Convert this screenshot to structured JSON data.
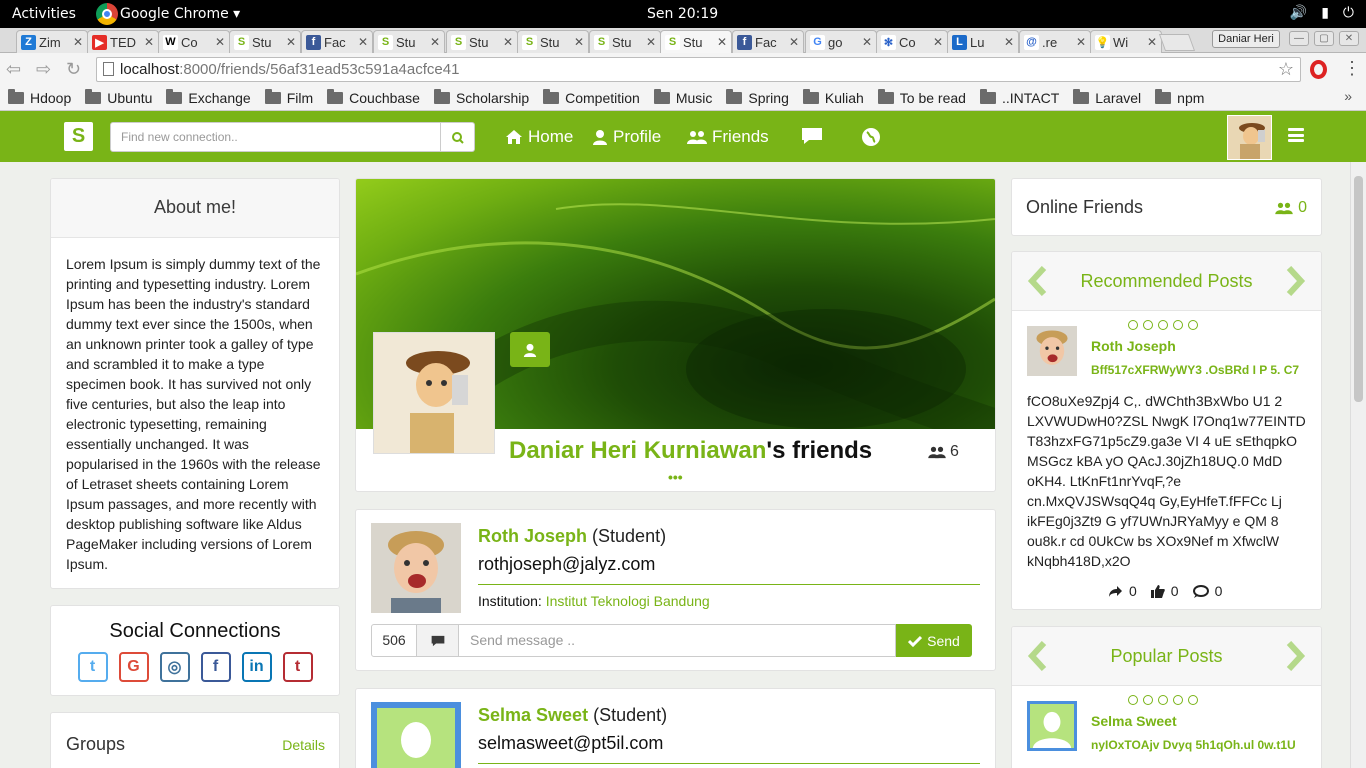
{
  "os": {
    "activities": "Activities",
    "app_menu": "Google Chrome ▾",
    "clock": "Sen 20:19"
  },
  "browser": {
    "tabs": [
      {
        "label": "Zim",
        "icon": "Z",
        "icon_bg": "#1f7ad6",
        "icon_color": "#ffffff"
      },
      {
        "label": "TED",
        "icon": "▶",
        "icon_bg": "#e52d27",
        "icon_color": "#ffffff"
      },
      {
        "label": "Co",
        "icon": "W",
        "icon_bg": "#ffffff",
        "icon_color": "#000000"
      },
      {
        "label": "Stu",
        "icon": "S",
        "icon_bg": "#ffffff",
        "icon_color": "#79b417"
      },
      {
        "label": "Fac",
        "icon": "f",
        "icon_bg": "#3b5998",
        "icon_color": "#ffffff"
      },
      {
        "label": "Stu",
        "icon": "S",
        "icon_bg": "#ffffff",
        "icon_color": "#79b417"
      },
      {
        "label": "Stu",
        "icon": "S",
        "icon_bg": "#ffffff",
        "icon_color": "#79b417"
      },
      {
        "label": "Stu",
        "icon": "S",
        "icon_bg": "#ffffff",
        "icon_color": "#79b417"
      },
      {
        "label": "Stu",
        "icon": "S",
        "icon_bg": "#ffffff",
        "icon_color": "#79b417"
      },
      {
        "label": "Stu",
        "icon": "S",
        "icon_bg": "#ffffff",
        "icon_color": "#79b417"
      },
      {
        "label": "Fac",
        "icon": "f",
        "icon_bg": "#3b5998",
        "icon_color": "#ffffff"
      },
      {
        "label": "go",
        "icon": "G",
        "icon_bg": "#ffffff",
        "icon_color": "#4285f4"
      },
      {
        "label": "Co",
        "icon": "✻",
        "icon_bg": "#ffffff",
        "icon_color": "#2a62c9"
      },
      {
        "label": "Lu",
        "icon": "L",
        "icon_bg": "#1b6ac9",
        "icon_color": "#ffffff"
      },
      {
        "label": ".re",
        "icon": "@",
        "icon_bg": "#ffffff",
        "icon_color": "#2a62c9"
      },
      {
        "label": "Wi",
        "icon": "💡",
        "icon_bg": "#ffffff",
        "icon_color": "#e0a000"
      }
    ],
    "profile_name": "Daniar Heri",
    "url_host": "localhost",
    "url_rest": ":8000/friends/56af31ead53c591a4acfce41",
    "bookmarks": [
      "Hdoop",
      "Ubuntu",
      "Exchange",
      "Film",
      "Couchbase",
      "Scholarship",
      "Competition",
      "Music",
      "Spring",
      "Kuliah",
      "To be read",
      "..INTACT",
      "Laravel",
      "npm"
    ],
    "bookmarks_more": "»"
  },
  "app": {
    "brand": "S",
    "search_placeholder": "Find new connection..",
    "nav": {
      "home": "Home",
      "profile": "Profile",
      "friends": "Friends"
    },
    "accent": "#79b417"
  },
  "about": {
    "title": "About me!",
    "text": "Lorem Ipsum is simply dummy text of the printing and typesetting industry. Lorem Ipsum has been the industry's standard dummy text ever since the 1500s, when an unknown printer took a galley of type and scrambled it to make a type specimen book. It has survived not only five centuries, but also the leap into electronic typesetting, remaining essentially unchanged. It was popularised in the 1960s with the release of Letraset sheets containing Lorem Ipsum passages, and more recently with desktop publishing software like Aldus PageMaker including versions of Lorem Ipsum."
  },
  "social": {
    "title": "Social Connections",
    "icons": [
      {
        "name": "twitter-icon",
        "glyph": "t",
        "color": "#55acee"
      },
      {
        "name": "google-plus-icon",
        "glyph": "G",
        "color": "#dd4b39"
      },
      {
        "name": "instagram-icon",
        "glyph": "◎",
        "color": "#3f729b"
      },
      {
        "name": "facebook-icon",
        "glyph": "f",
        "color": "#3b5998"
      },
      {
        "name": "linkedin-icon",
        "glyph": "in",
        "color": "#0976b4"
      },
      {
        "name": "tumblr-icon",
        "glyph": "t",
        "color": "#b52c33"
      }
    ]
  },
  "groups": {
    "title": "Groups",
    "details": "Details"
  },
  "profile": {
    "name": "Daniar Heri Kurniawan",
    "suffix": "'s friends",
    "friend_count": "6",
    "more": "•••"
  },
  "friends": [
    {
      "name": "Roth Joseph",
      "role": "(Student)",
      "email": "rothjoseph@jalyz.com",
      "institution_label": "Institution:",
      "institution": "Institut Teknologi Bandung",
      "message_count": "506",
      "message_placeholder": "Send message ..",
      "send_label": "Send"
    },
    {
      "name": "Selma Sweet",
      "role": "(Student)",
      "email": "selmasweet@pt5il.com"
    }
  ],
  "online": {
    "title": "Online Friends",
    "count": "0"
  },
  "recommended": {
    "title": "Recommended Posts",
    "author": "Roth Joseph",
    "subtitle": "Bff517cXFRWyWY3 .OsBRd I P 5. C7",
    "body": "fCO8uXe9Zpj4 C,. dWChth3BxWbo U1 2 LXVWUDwH0?ZSL NwgK l7Onq1w77EINTD T83hzxFG71p5cZ9.ga3e VI 4 uE sEthqpkO MSGcz kBA yO QAcJ.30jZh18UQ.0 MdD oKH4. LtKnFt1nrYvqF,?e cn.MxQVJSWsqQ4q Gy,EyHfeT.fFFCc Lj ikFEg0j3Zt9 G yf7UWnJRYaMyy e QM 8 ou8k.r cd 0UkCw bs XOx9Nef m XfwclW kNqbh418D,x2O",
    "shares": "0",
    "likes": "0",
    "comments": "0"
  },
  "popular": {
    "title": "Popular Posts",
    "author": "Selma Sweet",
    "subtitle": "nyIOxTOAjv Dvyq 5h1qOh.ul 0w.t1U"
  }
}
